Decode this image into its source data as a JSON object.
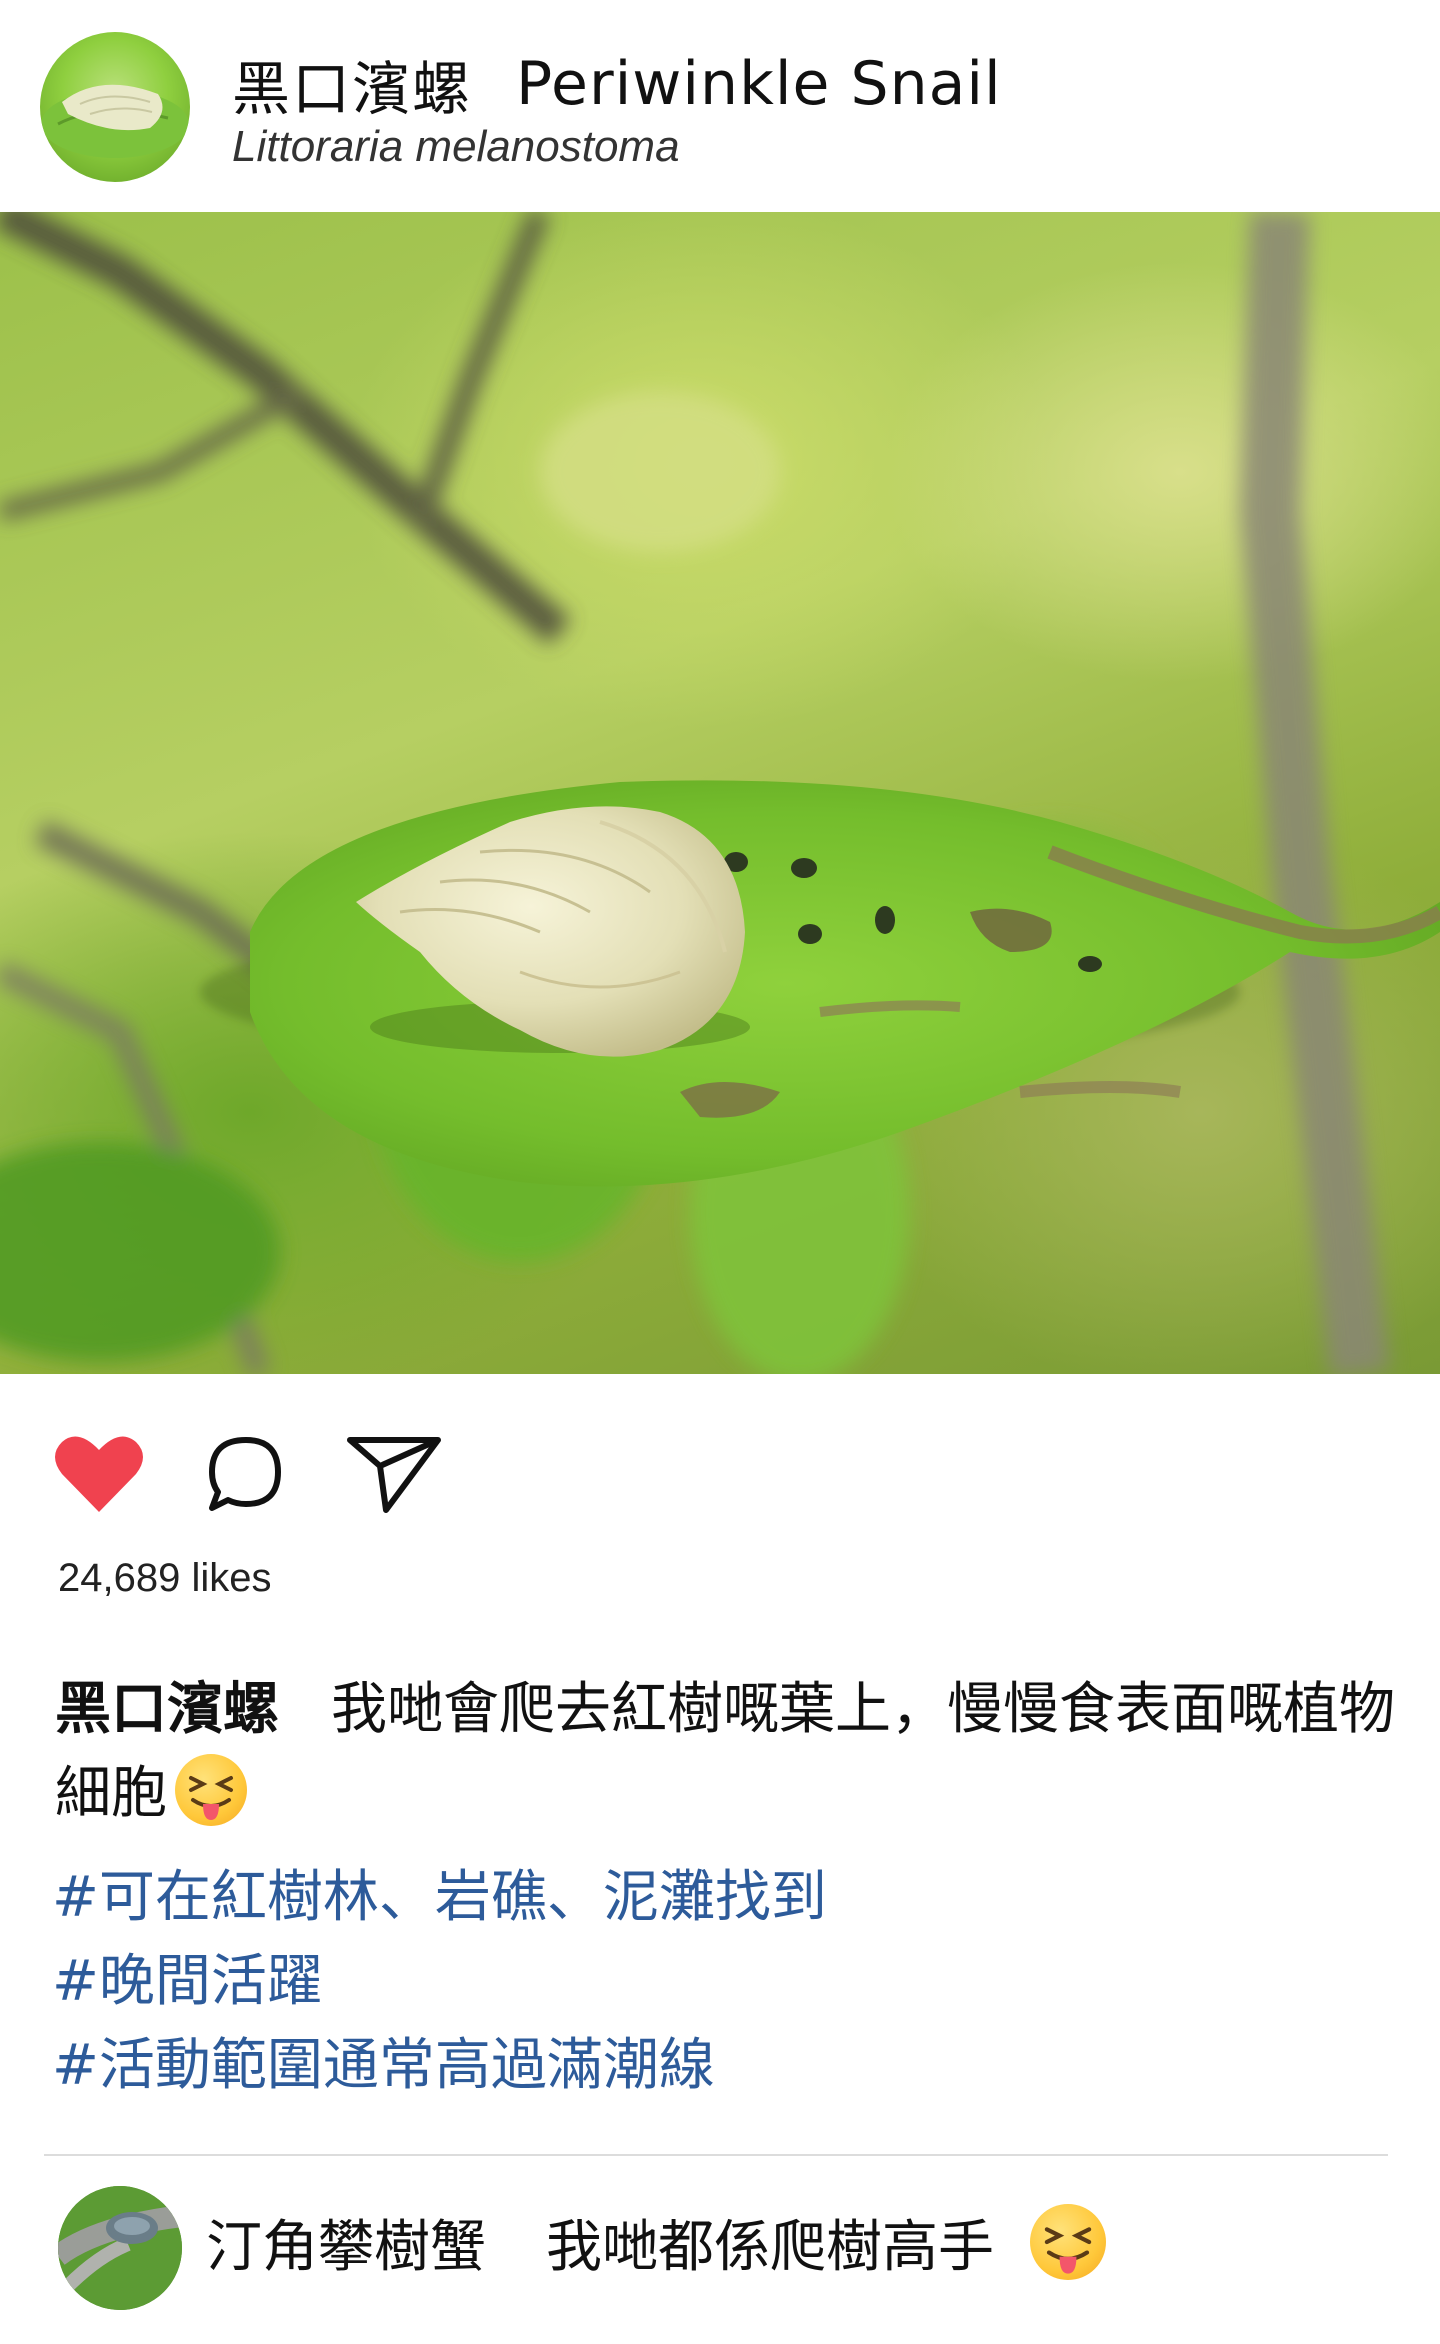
{
  "post": {
    "name_zh": "黑口濱螺",
    "name_en": "Periwinkle Snail",
    "scientific_name": "Littoraria melanostoma",
    "avatar_icon": "snail-on-leaf-avatar",
    "photo_description_icon": "snail-on-leaf-photo"
  },
  "actions": {
    "like_icon": "heart-icon",
    "comment_icon": "comment-bubble-icon",
    "share_icon": "send-icon",
    "like_color": "#f0424f",
    "liked": true
  },
  "likes_text": "24,689 likes",
  "caption": {
    "user": "黑口濱螺",
    "text": "我哋會爬去紅樹嘅葉上，慢慢食表面嘅植物細胞",
    "emoji": "squinting-tongue-emoji"
  },
  "hashtags": [
    "#可在紅樹林、岩礁、泥灘找到",
    "#晚間活躍",
    "#活動範圍通常高過滿潮線"
  ],
  "hashtag_color": "#2d5b9a",
  "comment": {
    "user": "汀角攀樹蟹",
    "text": "我哋都係爬樹高手",
    "emoji": "squinting-tongue-emoji",
    "avatar_icon": "crab-on-branch-avatar"
  }
}
